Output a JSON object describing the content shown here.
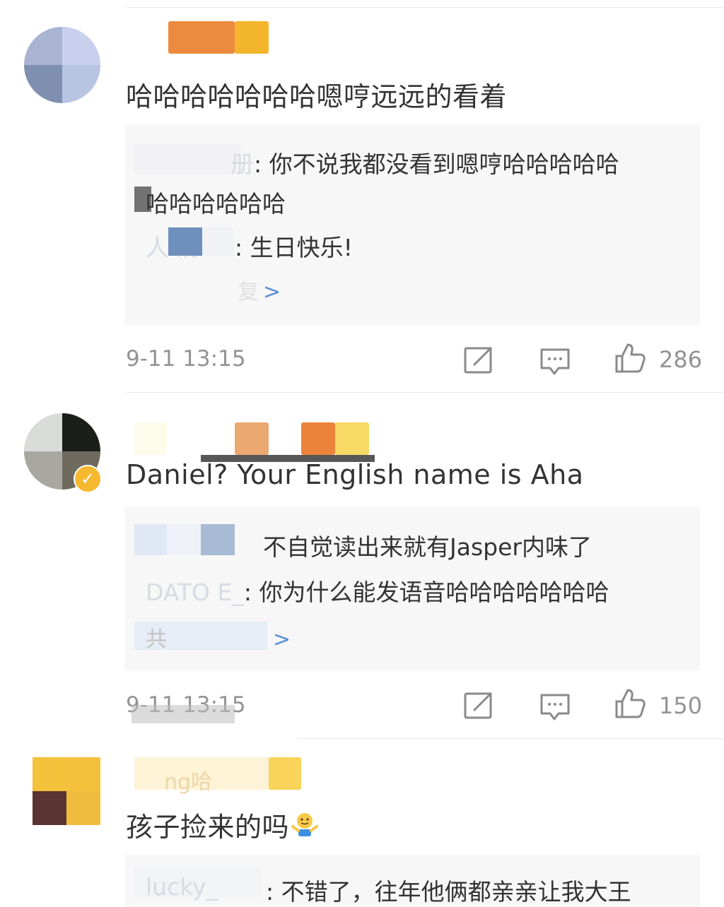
{
  "comments": [
    {
      "text": "哈哈哈哈哈哈哈嗯哼远远的看着",
      "replies": [
        {
          "nick": "册",
          "text": "你不说我都没看到嗯哼哈哈哈哈哈",
          "text2": "哈哈哈哈哈哈"
        },
        {
          "nick": "人 清",
          "text": "生日快乐!"
        }
      ],
      "more_label": "复",
      "time": "9-11 13:15",
      "likes": "286"
    },
    {
      "text": "Daniel? Your English name is Aha",
      "verified": true,
      "replies": [
        {
          "nick": "",
          "text": "不自觉读出来就有Jasper内味了"
        },
        {
          "nick": "DATO E_",
          "text": "你为什么能发语音哈哈哈哈哈哈哈"
        }
      ],
      "more_label": "共",
      "time": "9-11 13:15",
      "likes": "150"
    },
    {
      "nick_partial": "ng哈",
      "text": "孩子捡来的吗",
      "emoji": "shrug-emoji",
      "replies": [
        {
          "nick": "lucky_",
          "text": "不错了，往年他俩都亲亲让我大王"
        }
      ]
    }
  ],
  "icons": {
    "share": "share-icon",
    "comment": "comment-icon",
    "like": "thumbs-up-icon",
    "more": "chevron-right-icon"
  },
  "colors": {
    "link_blue": "#5b8fd6",
    "meta_gray": "#939393",
    "reply_bg": "#f7f7f7",
    "verified_badge": "#f5b82e"
  }
}
